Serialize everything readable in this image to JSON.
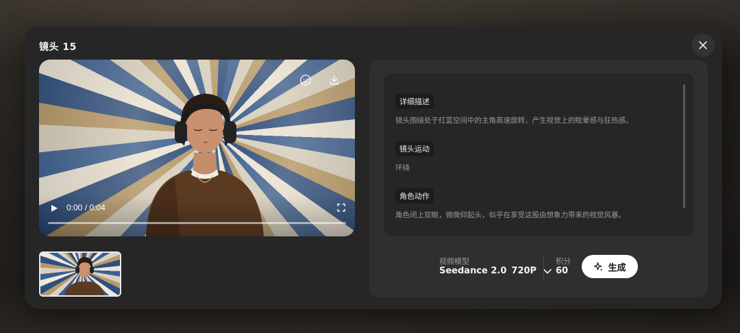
{
  "modal": {
    "title": "镜头 15",
    "close_icon": "close-icon"
  },
  "video": {
    "current_time": "0:00",
    "separator": "/",
    "duration": "0:04",
    "progress": 0.0,
    "icons": [
      "face-icon",
      "download-icon",
      "play-icon",
      "fullscreen-icon"
    ]
  },
  "details": {
    "sections": [
      {
        "label": "详细描述",
        "text": "镜头围绕处于红蓝空间中的主角高速旋转，产生视觉上的眩晕感与狂热感。"
      },
      {
        "label": "镜头运动",
        "text": "环绕"
      },
      {
        "label": "角色动作",
        "text": "角色闭上双眼，微微仰起头，似乎在享受这股由想象力带来的视觉风暴。"
      }
    ]
  },
  "generation": {
    "model_label": "视频模型",
    "model_name": "Seedance 2.0",
    "resolution": "720P",
    "credits_label": "积分",
    "credits_value": "60",
    "generate_label": "生成"
  },
  "colors": {
    "modal_bg": "#262626",
    "panel_bg": "#2f2f2f",
    "button_bg": "#ffffff"
  }
}
